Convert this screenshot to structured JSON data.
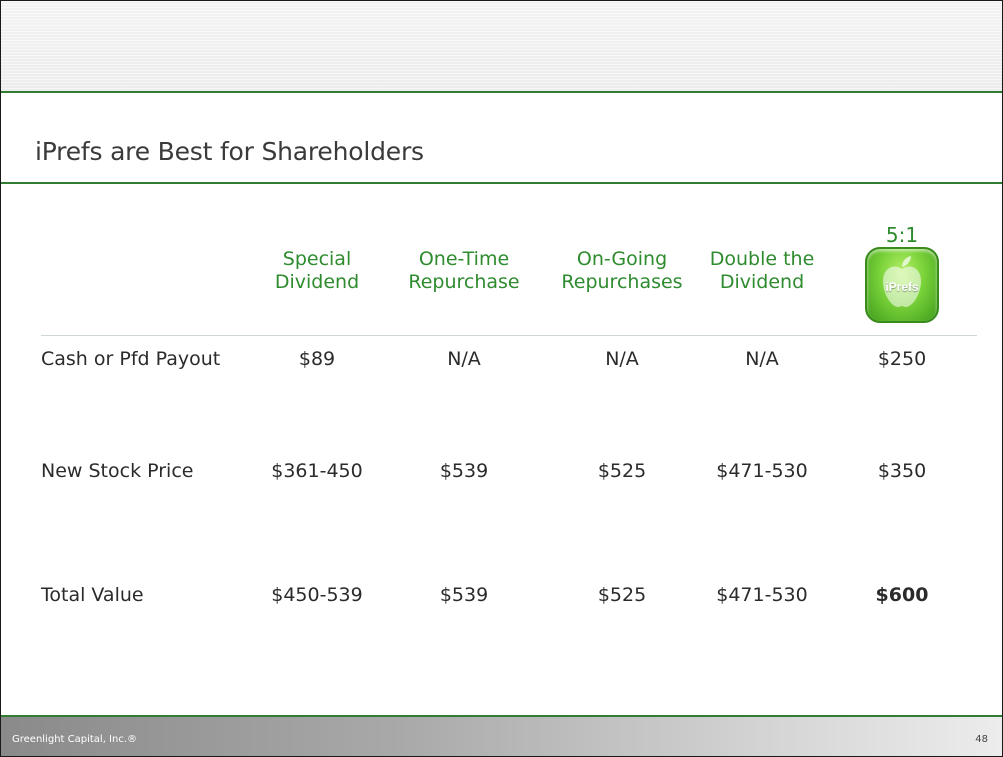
{
  "slide": {
    "title": "iPrefs are Best for Shareholders",
    "page_number": "48",
    "footer_company": "Greenlight Capital, Inc.®"
  },
  "table": {
    "columns": [
      {
        "line1": "Special",
        "line2": "Dividend"
      },
      {
        "line1": "One-Time",
        "line2": "Repurchase"
      },
      {
        "line1": "On-Going",
        "line2": "Repurchases"
      },
      {
        "line1": "Double the",
        "line2": "Dividend"
      }
    ],
    "ipref_column": {
      "ratio": "5:1",
      "icon_label": "iPrefs",
      "icon": "apple-iprefs-icon"
    },
    "rows": [
      {
        "label": "Cash or Pfd Payout",
        "cells": [
          "$89",
          "N/A",
          "N/A",
          "N/A",
          "$250"
        ]
      },
      {
        "label": "New Stock Price",
        "cells": [
          "$361-450",
          "$539",
          "$525",
          "$471-530",
          "$350"
        ]
      },
      {
        "label": "Total Value",
        "cells": [
          "$450-539",
          "$539",
          "$525",
          "$471-530",
          "$600"
        ]
      }
    ]
  },
  "colors": {
    "accent_green": "#2e8b2e",
    "rule_green": "#2e7d32",
    "text": "#2b2b2b"
  }
}
